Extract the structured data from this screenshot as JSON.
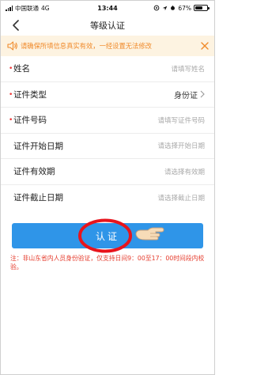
{
  "status_bar": {
    "carrier": "中国联通",
    "network": "4G",
    "time": "13:44",
    "battery": "67%",
    "battery_level": 0.67
  },
  "nav": {
    "title": "等级认证",
    "back_icon": "chevron-left-icon"
  },
  "notice": {
    "text": "请确保所填信息真实有效，一经设置无法修改",
    "color": "#f08a2a",
    "background": "#fdf3e1"
  },
  "form": {
    "rows": [
      {
        "label": "姓名",
        "required": true,
        "placeholder": "请填写姓名",
        "value": ""
      },
      {
        "label": "证件类型",
        "required": true,
        "placeholder": "",
        "value": "身份证"
      },
      {
        "label": "证件号码",
        "required": true,
        "placeholder": "请填写证件号码",
        "value": ""
      },
      {
        "label": "证件开始日期",
        "required": false,
        "placeholder": "请选择开始日期",
        "value": ""
      },
      {
        "label": "证件有效期",
        "required": false,
        "placeholder": "请选择有效期",
        "value": ""
      },
      {
        "label": "证件截止日期",
        "required": false,
        "placeholder": "请选择截止日期",
        "value": ""
      }
    ]
  },
  "submit": {
    "label": "认证",
    "color": "#2f95e8"
  },
  "footnote": {
    "text": "注：非山东省内人员身份验证，仅支持日间9：00至17：00时间段内校验。",
    "color": "#e53b2c"
  }
}
